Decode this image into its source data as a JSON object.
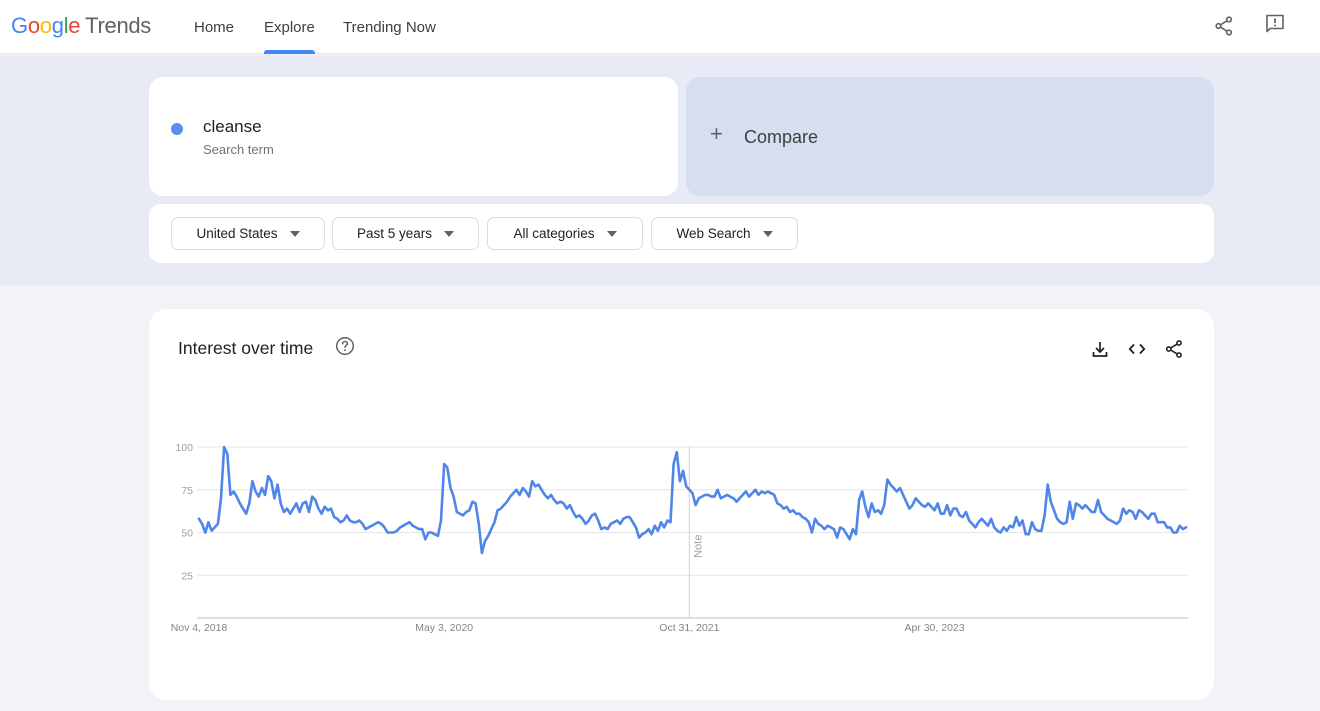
{
  "header": {
    "logo": {
      "google": "Google",
      "product": "Trends"
    },
    "nav": [
      {
        "label": "Home",
        "active": false
      },
      {
        "label": "Explore",
        "active": true
      },
      {
        "label": "Trending Now",
        "active": false
      }
    ],
    "icons": [
      "share-icon",
      "feedback-icon"
    ]
  },
  "search": {
    "term": "cleanse",
    "term_sub": "Search term",
    "term_color": "#5b8def",
    "compare_label": "Compare"
  },
  "filters": [
    {
      "label": "United States"
    },
    {
      "label": "Past 5 years"
    },
    {
      "label": "All categories"
    },
    {
      "label": "Web Search"
    }
  ],
  "card": {
    "title": "Interest over time",
    "icons": [
      "help-icon",
      "download-icon",
      "embed-code-icon",
      "share-icon"
    ]
  },
  "chart_data": {
    "type": "line",
    "title": "Interest over time",
    "xlabel": "",
    "ylabel": "",
    "ylim": [
      0,
      100
    ],
    "yticks": [
      25,
      50,
      75,
      100
    ],
    "grid": true,
    "legend": "none",
    "x_tick_labels": [
      {
        "label": "Nov 4, 2018",
        "index": 0
      },
      {
        "label": "May 3, 2020",
        "index": 78
      },
      {
        "label": "Oct 31, 2021",
        "index": 156
      },
      {
        "label": "Apr 30, 2023",
        "index": 234
      }
    ],
    "annotation": {
      "label": "Note",
      "index": 156
    },
    "x_start": "Nov 4, 2018",
    "x_step": "weekly",
    "series": [
      {
        "name": "cleanse",
        "color": "#4f86e8",
        "values": [
          58,
          55,
          50,
          56,
          51,
          53,
          55,
          70,
          100,
          96,
          72,
          74,
          71,
          67,
          64,
          61,
          67,
          80,
          74,
          71,
          76,
          72,
          83,
          80,
          70,
          78,
          67,
          62,
          64,
          61,
          64,
          67,
          62,
          67,
          68,
          62,
          71,
          69,
          64,
          61,
          65,
          63,
          64,
          59,
          58,
          56,
          57,
          60,
          57,
          56,
          56,
          57,
          55,
          52,
          53,
          54,
          55,
          56,
          55,
          53,
          50,
          50,
          50,
          51,
          53,
          54,
          55,
          56,
          54,
          53,
          52,
          52,
          46,
          50,
          50,
          49,
          48,
          57,
          90,
          88,
          76,
          71,
          62,
          61,
          60,
          62,
          63,
          68,
          67,
          55,
          38,
          45,
          48,
          52,
          56,
          63,
          64,
          66,
          68,
          71,
          73,
          75,
          72,
          76,
          74,
          71,
          80,
          77,
          78,
          75,
          72,
          70,
          72,
          69,
          67,
          68,
          67,
          64,
          66,
          62,
          59,
          60,
          58,
          55,
          57,
          60,
          61,
          57,
          52,
          53,
          52,
          55,
          56,
          57,
          55,
          58,
          59,
          59,
          56,
          53,
          47,
          49,
          50,
          52,
          49,
          54,
          51,
          56,
          53,
          57,
          56,
          90,
          97,
          80,
          86,
          77,
          75,
          73,
          66,
          70,
          71,
          72,
          72,
          71,
          71,
          75,
          70,
          71,
          72,
          71,
          70,
          68,
          70,
          72,
          74,
          71,
          73,
          75,
          72,
          74,
          73,
          74,
          73,
          72,
          67,
          66,
          64,
          65,
          62,
          63,
          61,
          61,
          59,
          58,
          56,
          50,
          58,
          55,
          54,
          52,
          54,
          53,
          52,
          47,
          53,
          52,
          49,
          46,
          52,
          49,
          69,
          74,
          65,
          59,
          67,
          62,
          63,
          61,
          66,
          81,
          78,
          76,
          74,
          76,
          72,
          68,
          64,
          66,
          70,
          68,
          66,
          65,
          67,
          65,
          63,
          67,
          61,
          61,
          66,
          60,
          64,
          64,
          60,
          59,
          62,
          57,
          55,
          53,
          56,
          58,
          56,
          54,
          58,
          53,
          51,
          50,
          53,
          51,
          54,
          53,
          59,
          54,
          57,
          49,
          49,
          56,
          52,
          51,
          51,
          60,
          78,
          68,
          63,
          58,
          56,
          55,
          56,
          68,
          58,
          67,
          66,
          64,
          66,
          64,
          62,
          62,
          69,
          62,
          60,
          58,
          57,
          56,
          55,
          57,
          64,
          61,
          63,
          62,
          58,
          63,
          62,
          60,
          58,
          61,
          61,
          56,
          56,
          56,
          53,
          53,
          50,
          50,
          54,
          52,
          53
        ]
      }
    ]
  }
}
